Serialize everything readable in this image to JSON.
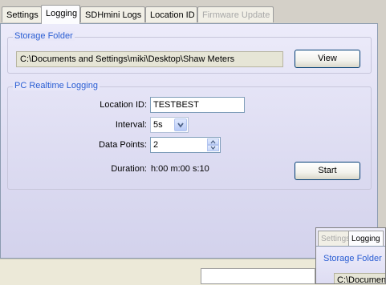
{
  "tabs": [
    {
      "label": "Settings",
      "active": false,
      "disabled": false
    },
    {
      "label": "Logging",
      "active": true,
      "disabled": false
    },
    {
      "label": "SDHmini Logs",
      "active": false,
      "disabled": false
    },
    {
      "label": "Location ID",
      "active": false,
      "disabled": false
    },
    {
      "label": "Firmware Update",
      "active": false,
      "disabled": true
    }
  ],
  "storage": {
    "title": "Storage Folder",
    "path": "C:\\Documents and Settings\\miki\\Desktop\\Shaw Meters",
    "view_label": "View"
  },
  "realtime": {
    "title": "PC Realtime Logging",
    "location_label": "Location ID:",
    "location_value": "TESTBEST",
    "interval_label": "Interval:",
    "interval_value": "5s",
    "datapoints_label": "Data Points:",
    "datapoints_value": "2",
    "duration_label": "Duration:",
    "duration_value": "h:00 m:00 s:10",
    "start_label": "Start"
  },
  "status": {
    "text": ""
  },
  "thumbnail": {
    "tab_settings": "Settings",
    "tab_logging": "Logging",
    "group_title": "Storage Folder",
    "path": "C:\\Documents"
  },
  "colors": {
    "accent": "#2a5ed3",
    "panel": "#e3e2f6",
    "frame": "#d4d0c8"
  }
}
